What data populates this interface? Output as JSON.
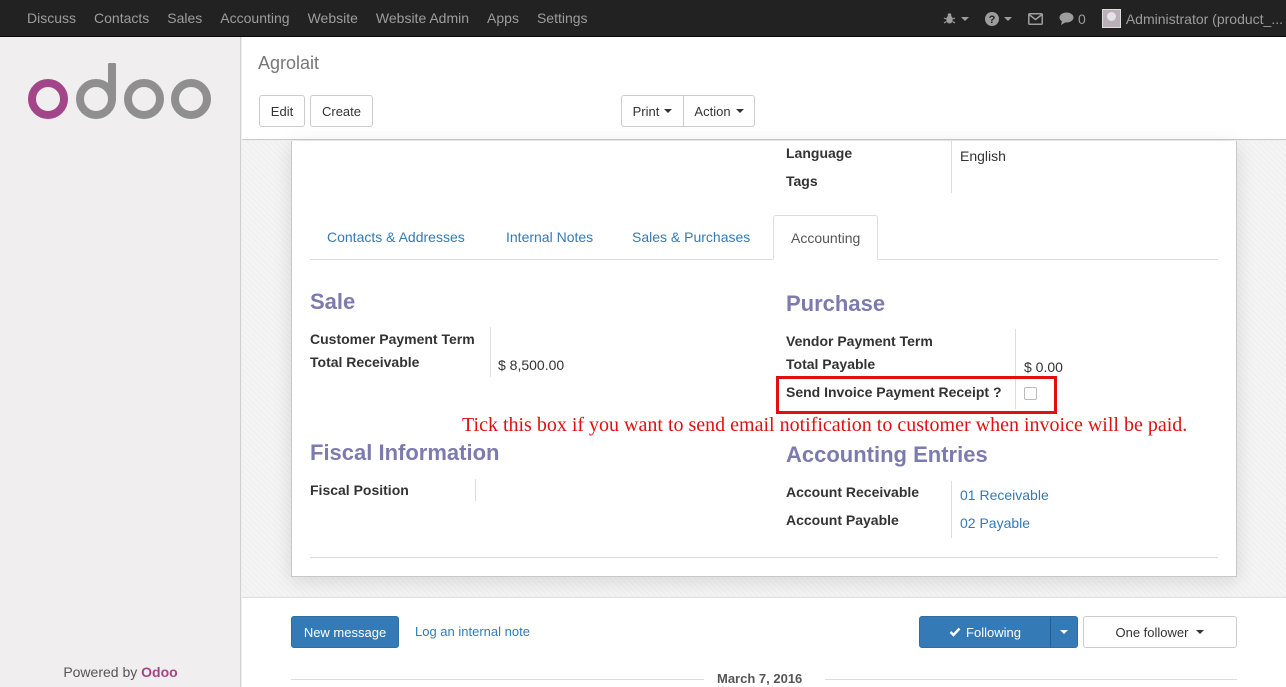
{
  "topbar": {
    "menu": [
      "Discuss",
      "Contacts",
      "Sales",
      "Accounting",
      "Website",
      "Website Admin",
      "Apps",
      "Settings"
    ],
    "message_count": "0",
    "user": "Administrator (product_..."
  },
  "sidebar": {
    "logo": "odoo",
    "powered_prefix": "Powered by",
    "powered_brand": "Odoo"
  },
  "control_panel": {
    "breadcrumb": "Agrolait",
    "edit": "Edit",
    "create": "Create",
    "print": "Print",
    "action": "Action"
  },
  "form": {
    "language_label": "Language",
    "language_value": "English",
    "tags_label": "Tags",
    "tabs": [
      "Contacts & Addresses",
      "Internal Notes",
      "Sales & Purchases",
      "Accounting"
    ],
    "active_tab": "Accounting",
    "sale": {
      "title": "Sale",
      "payment_term_label": "Customer Payment Term",
      "total_label": "Total Receivable",
      "total_value": "$ 8,500.00"
    },
    "purchase": {
      "title": "Purchase",
      "payment_term_label": "Vendor Payment Term",
      "total_label": "Total Payable",
      "total_value": "$ 0.00",
      "receipt_label": "Send Invoice Payment Receipt ?",
      "receipt_checked": false
    },
    "annotation": "Tick this box if you want to send email notification to customer when invoice will be paid.",
    "fiscal": {
      "title": "Fiscal Information",
      "position_label": "Fiscal Position"
    },
    "entries": {
      "title": "Accounting Entries",
      "receivable_label": "Account Receivable",
      "receivable_value": "01 Receivable",
      "payable_label": "Account Payable",
      "payable_value": "02 Payable"
    }
  },
  "chatter": {
    "new_message": "New message",
    "log_note": "Log an internal note",
    "following": "Following",
    "followers": "One follower",
    "date": "March 7, 2016"
  },
  "colors": {
    "accent": "#7c7bad",
    "brand": "#a24689",
    "primary": "#337ab7",
    "annotation": "#e01010"
  }
}
